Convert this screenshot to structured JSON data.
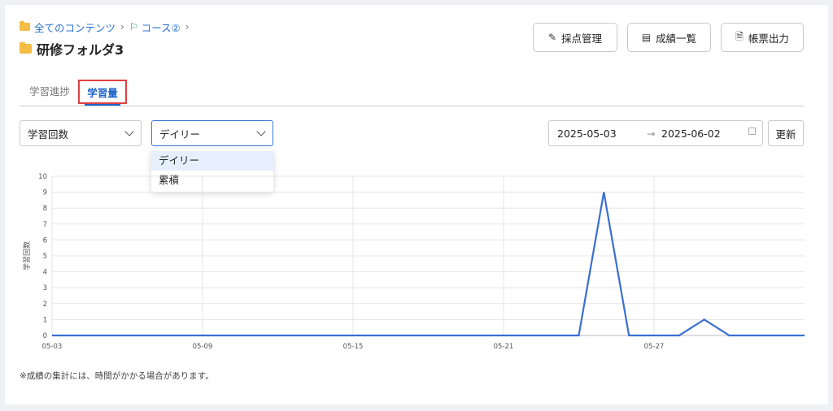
{
  "breadcrumb": {
    "root": "全てのコンテンツ",
    "course": "コース②"
  },
  "page_title": "研修フォルダ3",
  "buttons": {
    "grading": "採点管理",
    "grades_list": "成績一覧",
    "report_output": "帳票出力",
    "refresh": "更新"
  },
  "tabs": {
    "progress": "学習進捗",
    "volume": "学習量"
  },
  "filters": {
    "metric_selected": "学習回数",
    "period_selected": "デイリー",
    "period_options": [
      "デイリー",
      "累積"
    ]
  },
  "date_range": {
    "start": "2025-05-03",
    "arrow": "→",
    "end": "2025-06-02"
  },
  "note": "※成績の集計には、時間がかかる場合があります。",
  "colors": {
    "accent": "#1d63c8",
    "line": "#3a6fd0",
    "highlight_border": "#e04141"
  },
  "chart_data": {
    "type": "line",
    "ylabel": "学習回数",
    "xlabel": "",
    "ylim": [
      0,
      10
    ],
    "yticks": [
      0,
      1,
      2,
      3,
      4,
      5,
      6,
      7,
      8,
      9,
      10
    ],
    "xtick_labels": [
      "05-03",
      "05-09",
      "05-15",
      "05-21",
      "05-27"
    ],
    "grid": true,
    "x": [
      "05-03",
      "05-04",
      "05-05",
      "05-06",
      "05-07",
      "05-08",
      "05-09",
      "05-10",
      "05-11",
      "05-12",
      "05-13",
      "05-14",
      "05-15",
      "05-16",
      "05-17",
      "05-18",
      "05-19",
      "05-20",
      "05-21",
      "05-22",
      "05-23",
      "05-24",
      "05-25",
      "05-26",
      "05-27",
      "05-28",
      "05-29",
      "05-30",
      "05-31",
      "06-01",
      "06-02"
    ],
    "values": [
      0,
      0,
      0,
      0,
      0,
      0,
      0,
      0,
      0,
      0,
      0,
      0,
      0,
      0,
      0,
      0,
      0,
      0,
      0,
      0,
      0,
      0,
      9,
      0,
      0,
      0,
      1,
      0,
      0,
      0,
      0
    ]
  }
}
